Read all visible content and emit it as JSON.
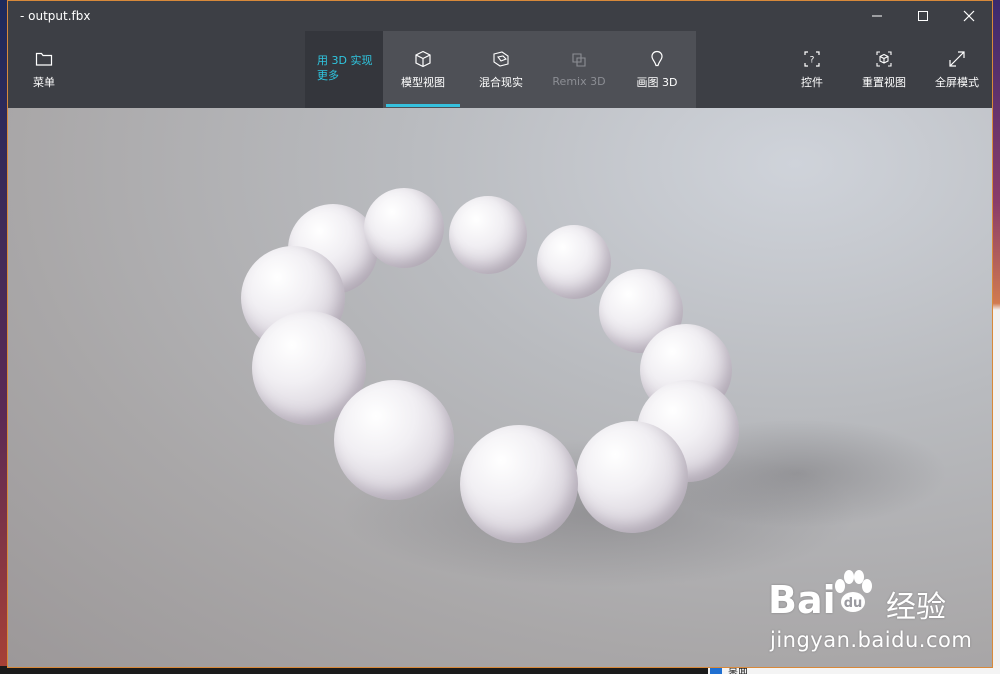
{
  "window": {
    "title": "- output.fbx"
  },
  "toolbar": {
    "menu_label": "菜单",
    "promo_label_line1": "用 3D 实现",
    "promo_label_line2": "更多",
    "tabs": [
      {
        "label": "模型视图",
        "icon": "cube-icon",
        "active": true
      },
      {
        "label": "混合现实",
        "icon": "mixed-reality-icon",
        "active": false
      },
      {
        "label": "Remix 3D",
        "icon": "remix-3d-icon",
        "active": false,
        "disabled": true
      },
      {
        "label": "画图 3D",
        "icon": "paint-3d-icon",
        "active": false
      }
    ],
    "right_actions": [
      {
        "label": "控件",
        "icon": "help-controls-icon"
      },
      {
        "label": "重置视图",
        "icon": "reset-view-icon"
      },
      {
        "label": "全屏模式",
        "icon": "fullscreen-icon"
      }
    ]
  },
  "colors": {
    "accent": "#36c1de",
    "titlebar": "#3d3f45",
    "window_border": "#d8893a"
  },
  "watermark": {
    "brand_prefix": "Bai",
    "brand_suffix": "经验",
    "url": "jingyan.baidu.com"
  },
  "desktop": {
    "task_label": "桌面"
  }
}
